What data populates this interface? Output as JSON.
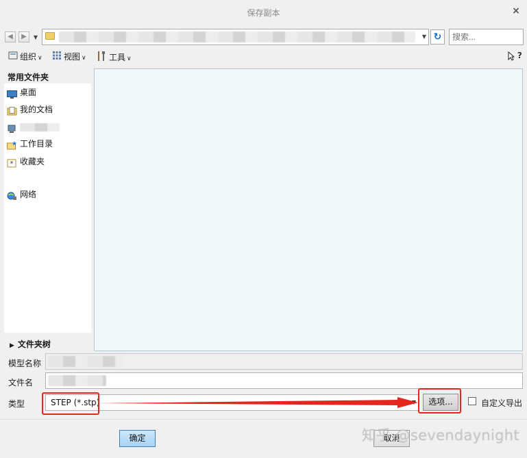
{
  "window": {
    "title": "保存副本",
    "close_glyph": "×"
  },
  "nav": {
    "back_icon": "arrow-left-icon",
    "forward_icon": "arrow-right-icon",
    "refresh_icon": "refresh-icon",
    "search_placeholder": "搜索..."
  },
  "toolbar": {
    "organize": "组织",
    "view": "视图",
    "tools": "工具",
    "help_glyph": "?"
  },
  "sidebar": {
    "header": "常用文件夹",
    "items": [
      {
        "label": "桌面",
        "icon": "desktop-icon"
      },
      {
        "label": "我的文档",
        "icon": "documents-icon"
      },
      {
        "label": "",
        "icon": "computer-icon"
      },
      {
        "label": "工作目录",
        "icon": "work-folder-icon"
      },
      {
        "label": "收藏夹",
        "icon": "favorites-icon"
      },
      {
        "label": "网络",
        "icon": "network-icon"
      }
    ],
    "folder_tree": "文件夹树"
  },
  "form": {
    "model_label": "模型名称",
    "file_label": "文件名",
    "type_label": "类型",
    "type_value": "STEP (*.stp)",
    "options_button": "选项...",
    "custom_export_label": "自定义导出",
    "custom_export_checked": false
  },
  "footer": {
    "ok": "确定",
    "cancel": "取消"
  },
  "watermark": "知乎 @sevendaynight",
  "colors": {
    "highlight": "#e3271f",
    "content_bg": "#f1f8fc",
    "ok_button": "#a9d4f5"
  }
}
